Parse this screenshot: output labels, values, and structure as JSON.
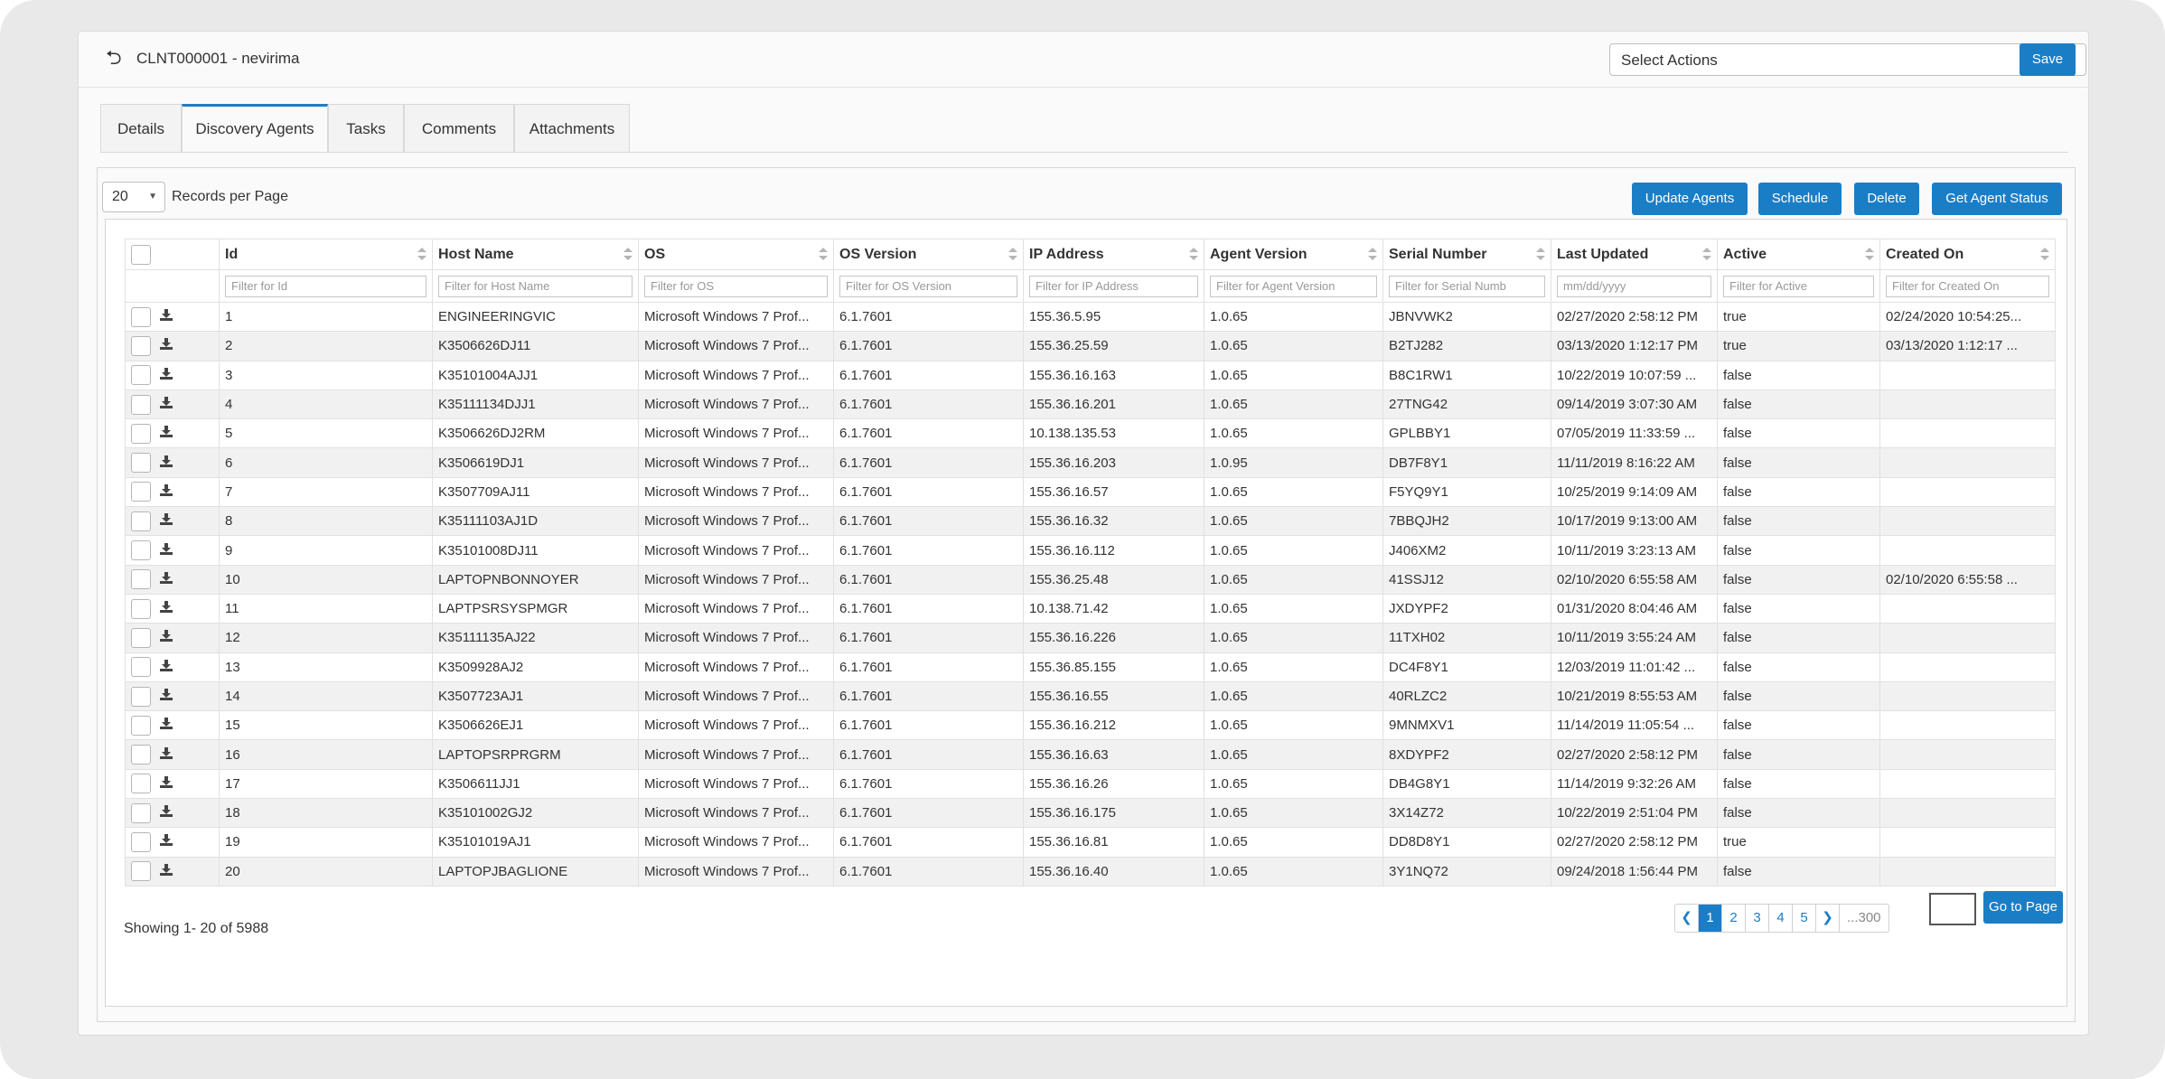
{
  "header": {
    "record_title": "CLNT000001 - nevirima",
    "select_actions_placeholder": "Select Actions",
    "save_label": "Save"
  },
  "tabs": [
    "Details",
    "Discovery Agents",
    "Tasks",
    "Comments",
    "Attachments"
  ],
  "active_tab": "Discovery Agents",
  "toolbar": {
    "records_per_page_value": "20",
    "records_per_page_label": "Records per Page",
    "update_agents_label": "Update Agents",
    "schedule_label": "Schedule",
    "delete_label": "Delete",
    "get_agent_status_label": "Get Agent Status"
  },
  "columns": [
    "Id",
    "Host Name",
    "OS",
    "OS Version",
    "IP Address",
    "Agent Version",
    "Serial Number",
    "Last Updated",
    "Active",
    "Created On"
  ],
  "filters": [
    "Filter for Id",
    "Filter for Host Name",
    "Filter for OS",
    "Filter for OS Version",
    "Filter for IP Address",
    "Filter for Agent Version",
    "Filter for Serial Numb",
    "mm/dd/yyyy",
    "Filter for Active",
    "Filter for Created On"
  ],
  "rows": [
    [
      "1",
      "ENGINEERINGVIC",
      "Microsoft Windows 7 Prof...",
      "6.1.7601",
      "155.36.5.95",
      "1.0.65",
      "JBNVWK2",
      "02/27/2020 2:58:12 PM",
      "true",
      "02/24/2020 10:54:25..."
    ],
    [
      "2",
      "K3506626DJ11",
      "Microsoft Windows 7 Prof...",
      "6.1.7601",
      "155.36.25.59",
      "1.0.65",
      "B2TJ282",
      "03/13/2020 1:12:17 PM",
      "true",
      "03/13/2020 1:12:17 ..."
    ],
    [
      "3",
      "K35101004AJJ1",
      "Microsoft Windows 7 Prof...",
      "6.1.7601",
      "155.36.16.163",
      "1.0.65",
      "B8C1RW1",
      "10/22/2019 10:07:59 ...",
      "false",
      ""
    ],
    [
      "4",
      "K35111134DJJ1",
      "Microsoft Windows 7 Prof...",
      "6.1.7601",
      "155.36.16.201",
      "1.0.65",
      "27TNG42",
      "09/14/2019 3:07:30 AM",
      "false",
      ""
    ],
    [
      "5",
      "K3506626DJ2RM",
      "Microsoft Windows 7 Prof...",
      "6.1.7601",
      "10.138.135.53",
      "1.0.65",
      "GPLBBY1",
      "07/05/2019 11:33:59 ...",
      "false",
      ""
    ],
    [
      "6",
      "K3506619DJ1",
      "Microsoft Windows 7 Prof...",
      "6.1.7601",
      "155.36.16.203",
      "1.0.95",
      "DB7F8Y1",
      "11/11/2019 8:16:22 AM",
      "false",
      ""
    ],
    [
      "7",
      "K3507709AJ11",
      "Microsoft Windows 7 Prof...",
      "6.1.7601",
      "155.36.16.57",
      "1.0.65",
      "F5YQ9Y1",
      "10/25/2019 9:14:09 AM",
      "false",
      ""
    ],
    [
      "8",
      "K35111103AJ1D",
      "Microsoft Windows 7 Prof...",
      "6.1.7601",
      "155.36.16.32",
      "1.0.65",
      "7BBQJH2",
      "10/17/2019 9:13:00 AM",
      "false",
      ""
    ],
    [
      "9",
      "K35101008DJ11",
      "Microsoft Windows 7 Prof...",
      "6.1.7601",
      "155.36.16.112",
      "1.0.65",
      "J406XM2",
      "10/11/2019 3:23:13 AM",
      "false",
      ""
    ],
    [
      "10",
      "LAPTOPNBONNOYER",
      "Microsoft Windows 7 Prof...",
      "6.1.7601",
      "155.36.25.48",
      "1.0.65",
      "41SSJ12",
      "02/10/2020 6:55:58 AM",
      "false",
      "02/10/2020 6:55:58 ..."
    ],
    [
      "11",
      "LAPTPSRSYSPMGR",
      "Microsoft Windows 7 Prof...",
      "6.1.7601",
      "10.138.71.42",
      "1.0.65",
      "JXDYPF2",
      "01/31/2020 8:04:46 AM",
      "false",
      ""
    ],
    [
      "12",
      "K35111135AJ22",
      "Microsoft Windows 7 Prof...",
      "6.1.7601",
      "155.36.16.226",
      "1.0.65",
      "11TXH02",
      "10/11/2019 3:55:24 AM",
      "false",
      ""
    ],
    [
      "13",
      "K3509928AJ2",
      "Microsoft Windows 7 Prof...",
      "6.1.7601",
      "155.36.85.155",
      "1.0.65",
      "DC4F8Y1",
      "12/03/2019 11:01:42 ...",
      "false",
      ""
    ],
    [
      "14",
      "K3507723AJ1",
      "Microsoft Windows 7 Prof...",
      "6.1.7601",
      "155.36.16.55",
      "1.0.65",
      "40RLZC2",
      "10/21/2019 8:55:53 AM",
      "false",
      ""
    ],
    [
      "15",
      "K3506626EJ1",
      "Microsoft Windows 7 Prof...",
      "6.1.7601",
      "155.36.16.212",
      "1.0.65",
      "9MNMXV1",
      "11/14/2019 11:05:54 ...",
      "false",
      ""
    ],
    [
      "16",
      "LAPTOPSRPRGRM",
      "Microsoft Windows 7 Prof...",
      "6.1.7601",
      "155.36.16.63",
      "1.0.65",
      "8XDYPF2",
      "02/27/2020 2:58:12 PM",
      "false",
      ""
    ],
    [
      "17",
      "K3506611JJ1",
      "Microsoft Windows 7 Prof...",
      "6.1.7601",
      "155.36.16.26",
      "1.0.65",
      "DB4G8Y1",
      "11/14/2019 9:32:26 AM",
      "false",
      ""
    ],
    [
      "18",
      "K35101002GJ2",
      "Microsoft Windows 7 Prof...",
      "6.1.7601",
      "155.36.16.175",
      "1.0.65",
      "3X14Z72",
      "10/22/2019 2:51:04 PM",
      "false",
      ""
    ],
    [
      "19",
      "K35101019AJ1",
      "Microsoft Windows 7 Prof...",
      "6.1.7601",
      "155.36.16.81",
      "1.0.65",
      "DD8D8Y1",
      "02/27/2020 2:58:12 PM",
      "true",
      ""
    ],
    [
      "20",
      "LAPTOPJBAGLIONE",
      "Microsoft Windows 7 Prof...",
      "6.1.7601",
      "155.36.16.40",
      "1.0.65",
      "3Y1NQ72",
      "09/24/2018 1:56:44 PM",
      "false",
      ""
    ]
  ],
  "footer": {
    "showing_text": "Showing 1- 20 of 5988",
    "pages": [
      "1",
      "2",
      "3",
      "4",
      "5"
    ],
    "last_page": "...300",
    "go_to_page_label": "Go to Page"
  },
  "colors": {
    "accent": "#1a7ec7"
  }
}
